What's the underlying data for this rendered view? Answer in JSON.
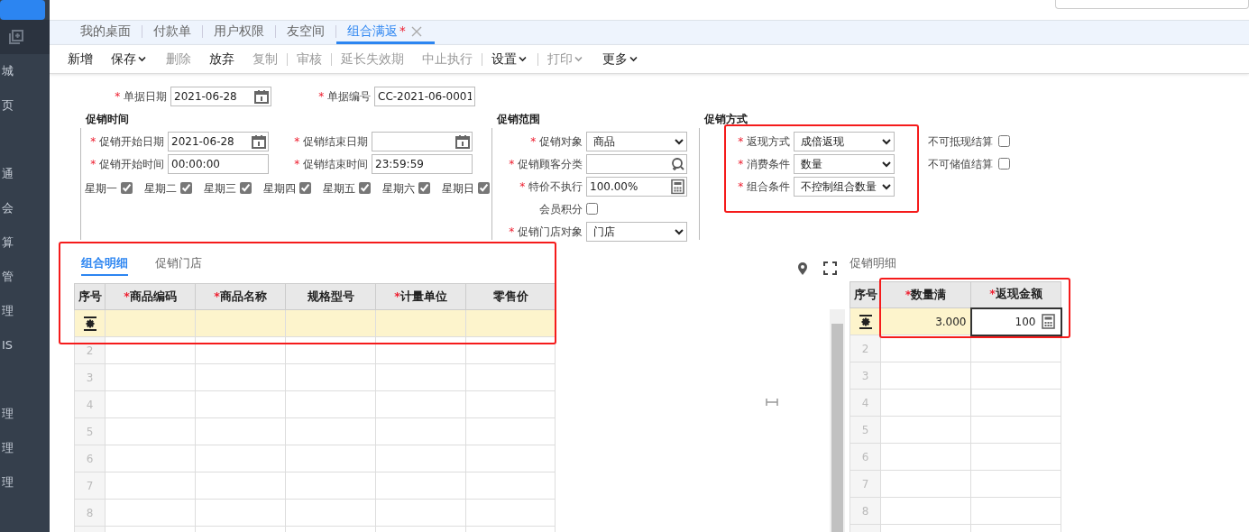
{
  "sidebar": {
    "items": [
      {
        "label": "城"
      },
      {
        "label": "页"
      },
      {
        "label": "通"
      },
      {
        "label": "会"
      },
      {
        "label": "算"
      },
      {
        "label": "管"
      },
      {
        "label": "理"
      },
      {
        "label": "IS"
      },
      {
        "label": "理"
      },
      {
        "label": "理"
      },
      {
        "label": "理"
      }
    ]
  },
  "tabs": [
    {
      "label": "我的桌面",
      "selected": false,
      "closable": false
    },
    {
      "label": "付款单",
      "selected": false,
      "closable": false
    },
    {
      "label": "用户权限",
      "selected": false,
      "closable": false
    },
    {
      "label": "友空间",
      "selected": false,
      "closable": false
    },
    {
      "label": "组合满返",
      "selected": true,
      "modified_mark": "*",
      "closable": true
    }
  ],
  "toolbar": [
    {
      "kind": "button",
      "label": "新增",
      "disabled": false,
      "dropdown": false
    },
    {
      "kind": "button",
      "label": "保存",
      "disabled": false,
      "dropdown": true
    },
    {
      "kind": "button",
      "label": "删除",
      "disabled": true,
      "dropdown": false
    },
    {
      "kind": "button",
      "label": "放弃",
      "disabled": false,
      "dropdown": false
    },
    {
      "kind": "button",
      "label": "复制",
      "disabled": true,
      "dropdown": false
    },
    {
      "kind": "separator"
    },
    {
      "kind": "button",
      "label": "审核",
      "disabled": true,
      "dropdown": false
    },
    {
      "kind": "separator"
    },
    {
      "kind": "button",
      "label": "延长失效期",
      "disabled": true,
      "dropdown": false
    },
    {
      "kind": "button",
      "label": "中止执行",
      "disabled": true,
      "dropdown": false
    },
    {
      "kind": "separator"
    },
    {
      "kind": "button",
      "label": "设置",
      "disabled": false,
      "dropdown": true
    },
    {
      "kind": "separator"
    },
    {
      "kind": "button",
      "label": "打印",
      "disabled": true,
      "dropdown": true
    },
    {
      "kind": "button",
      "label": "更多",
      "disabled": false,
      "dropdown": true
    }
  ],
  "header_fields": [
    {
      "marker": "*",
      "label": "单据日期",
      "kind": "date",
      "value": "2021-06-28"
    },
    {
      "marker": "*",
      "label": "单据编号",
      "kind": "text",
      "value": "CC-2021-06-0001"
    }
  ],
  "promo_time": {
    "title": "促销时间",
    "fields": [
      {
        "marker": "*",
        "label": "促销开始日期",
        "kind": "date",
        "value": "2021-06-28"
      },
      {
        "marker": "*",
        "label": "促销结束日期",
        "kind": "date"
      },
      {
        "marker": "*",
        "label": "促销开始时间",
        "kind": "text",
        "value": "00:00:00"
      },
      {
        "marker": "*",
        "label": "促销结束时间",
        "kind": "text",
        "value": "23:59:59"
      }
    ],
    "weekdays": [
      {
        "label": "星期一",
        "checked": true
      },
      {
        "label": "星期二",
        "checked": true
      },
      {
        "label": "星期三",
        "checked": true
      },
      {
        "label": "星期四",
        "checked": true
      },
      {
        "label": "星期五",
        "checked": true
      },
      {
        "label": "星期六",
        "checked": true
      },
      {
        "label": "星期日",
        "checked": true
      }
    ]
  },
  "promo_scope": {
    "title": "促销范围",
    "fields": [
      {
        "marker": "*",
        "label": "促销对象",
        "kind": "select",
        "value": "商品"
      },
      {
        "marker": "*",
        "label": "促销顾客分类",
        "kind": "lookup"
      },
      {
        "marker": "*",
        "label": "特价不执行",
        "kind": "number",
        "value": "100.00%"
      },
      {
        "label": "会员积分",
        "kind": "checkbox",
        "checked": false
      },
      {
        "marker": "*",
        "label": "促销门店对象",
        "kind": "select",
        "value": "门店"
      }
    ]
  },
  "promo_method": {
    "title": "促销方式",
    "highlighted": true,
    "fields": [
      {
        "marker": "*",
        "label": "返现方式",
        "kind": "select",
        "value": "成倍返现"
      },
      {
        "marker": "*",
        "label": "消费条件",
        "kind": "select",
        "value": "数量"
      },
      {
        "marker": "*",
        "label": "组合条件",
        "kind": "select",
        "value": "不控制组合数量"
      }
    ],
    "options": [
      {
        "label": "不可抵现结算",
        "checked": false
      },
      {
        "label": "不可储值结算",
        "checked": false
      }
    ]
  },
  "detail_panel": {
    "highlighted": true,
    "tabs": [
      {
        "label": "组合明细",
        "selected": true
      },
      {
        "label": "促销门店",
        "selected": false
      }
    ],
    "columns": [
      {
        "label": "序号"
      },
      {
        "marker": "*",
        "label": "商品编码"
      },
      {
        "marker": "*",
        "label": "商品名称"
      },
      {
        "label": "规格型号"
      },
      {
        "marker": "*",
        "label": "计量单位"
      },
      {
        "label": "零售价"
      }
    ],
    "rows": [
      {
        "kind": "current"
      },
      {
        "kind": "empty",
        "index": "2"
      },
      {
        "kind": "empty",
        "index": "3"
      },
      {
        "kind": "empty",
        "index": "4"
      },
      {
        "kind": "empty",
        "index": "5"
      },
      {
        "kind": "empty",
        "index": "6"
      },
      {
        "kind": "empty",
        "index": "7"
      },
      {
        "kind": "empty",
        "index": "8"
      },
      {
        "kind": "empty"
      }
    ]
  },
  "promo_detail": {
    "title": "促销明细",
    "highlighted": true,
    "columns": [
      {
        "label": "序号"
      },
      {
        "marker": "*",
        "label": "数量满"
      },
      {
        "marker": "*",
        "label": "返现金额"
      }
    ],
    "rows": [
      {
        "kind": "current",
        "cells": [
          "3.000",
          "100"
        ]
      },
      {
        "kind": "empty",
        "index": "2"
      },
      {
        "kind": "empty",
        "index": "3"
      },
      {
        "kind": "empty",
        "index": "4"
      },
      {
        "kind": "empty",
        "index": "5"
      },
      {
        "kind": "empty",
        "index": "6"
      },
      {
        "kind": "empty",
        "index": "7"
      },
      {
        "kind": "empty",
        "index": "8"
      },
      {
        "kind": "empty"
      }
    ]
  }
}
